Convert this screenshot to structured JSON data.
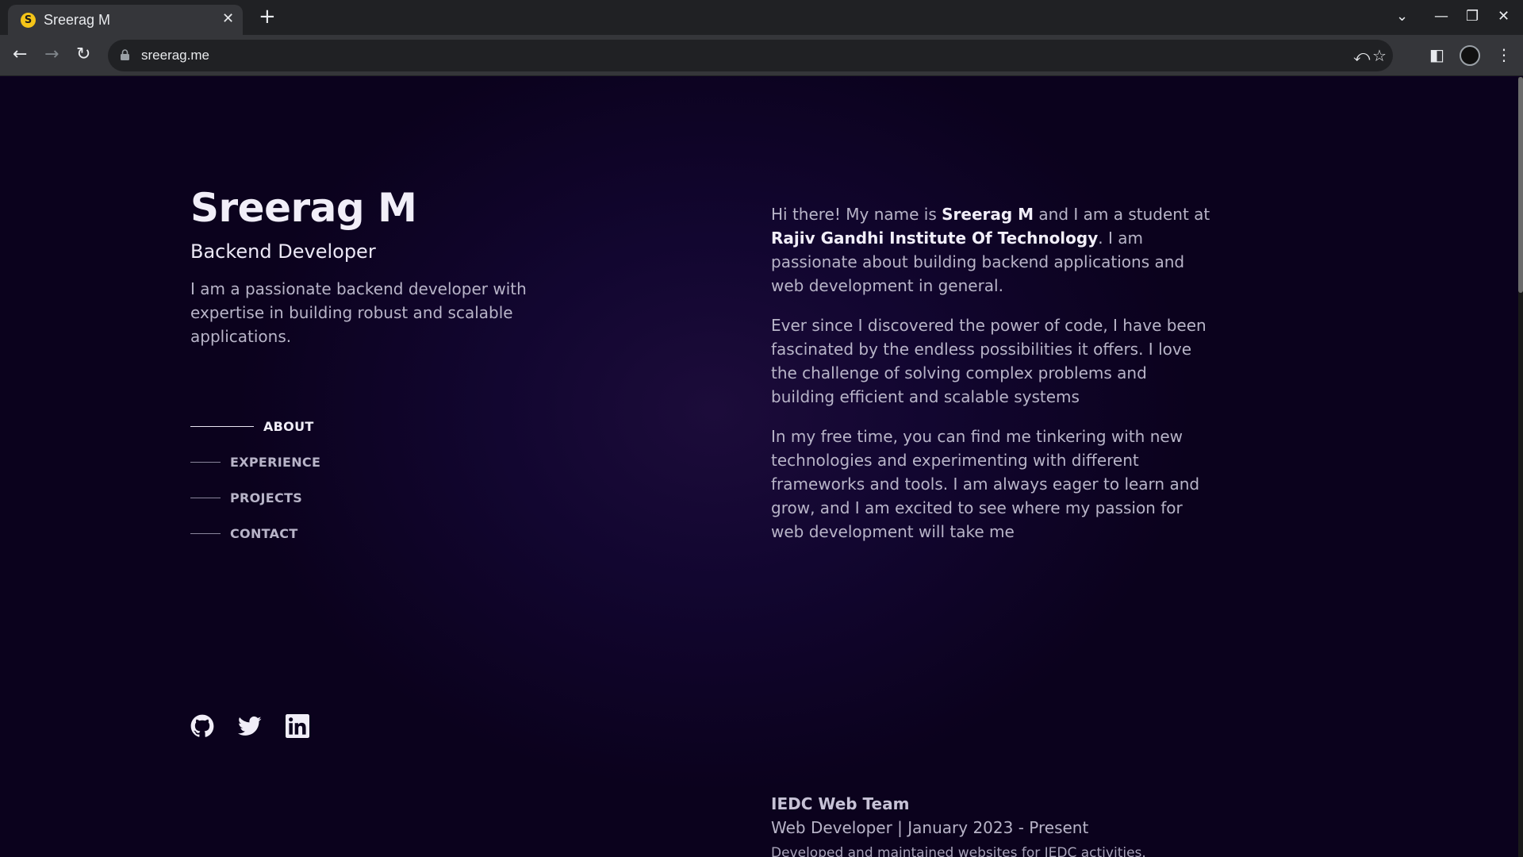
{
  "browser": {
    "tab_title": "Sreerag M",
    "favicon_letter": "S",
    "tab_close": "✕",
    "new_tab": "+",
    "url": "sreerag.me"
  },
  "hero": {
    "name": "Sreerag M",
    "role": "Backend Developer",
    "intro": "I am a passionate backend developer with expertise in building robust and scalable applications."
  },
  "nav": {
    "items": [
      {
        "label": "ABOUT",
        "active": true
      },
      {
        "label": "EXPERIENCE",
        "active": false
      },
      {
        "label": "PROJECTS",
        "active": false
      },
      {
        "label": "CONTACT",
        "active": false
      }
    ]
  },
  "socials": [
    {
      "icon": "github-icon"
    },
    {
      "icon": "twitter-icon"
    },
    {
      "icon": "linkedin-icon"
    }
  ],
  "about": {
    "p1_before_name": "Hi there! My name is ",
    "p1_name": "Sreerag M",
    "p1_mid": " and I am a student at ",
    "p1_school": "Rajiv Gandhi Institute Of Technology",
    "p1_after": ". I am passionate about building backend applications and web development in general.",
    "p2": "Ever since I discovered the power of code, I have been fascinated by the endless possibilities it offers. I love the challenge of solving complex problems and building efficient and scalable systems",
    "p3": "In my free time, you can find me tinkering with new technologies and experimenting with different frameworks and tools. I am always eager to learn and grow, and I am excited to see where my passion for web development will take me"
  },
  "experience": {
    "company": "IEDC Web Team",
    "role_dates": "Web Developer | January 2023 - Present",
    "description": "Developed and maintained websites for IEDC activities. Collaborated with team members on various web projects."
  },
  "colors": {
    "background": "#0d0221",
    "text": "#b8b4c8",
    "highlight": "#f1eef8"
  }
}
